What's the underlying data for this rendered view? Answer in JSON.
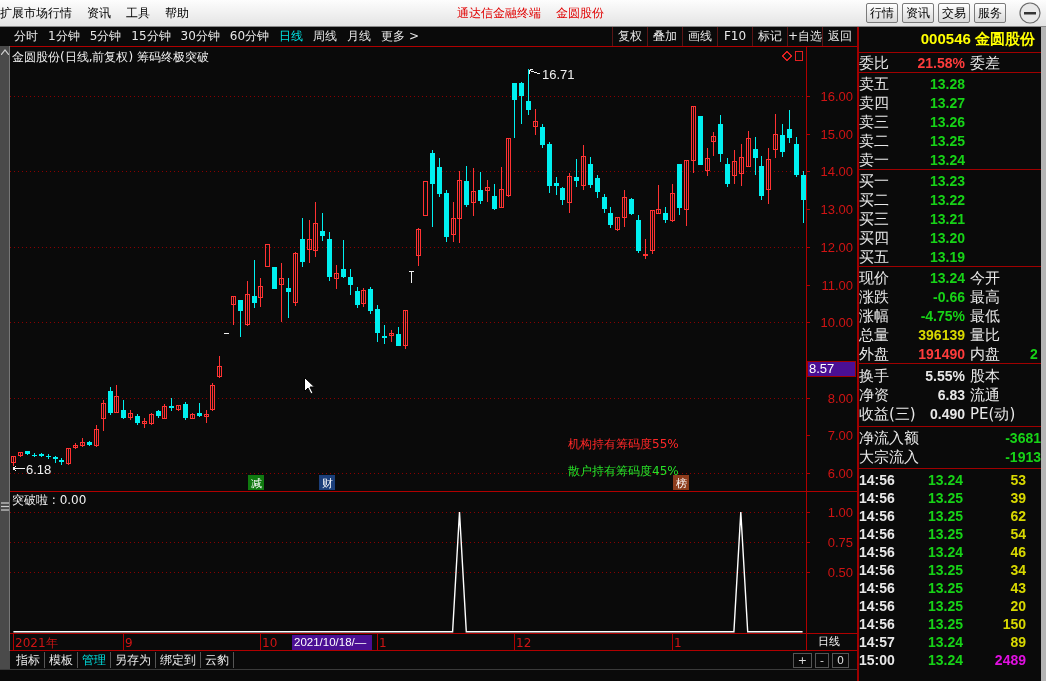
{
  "window": {
    "menu": [
      "扩展市场行情",
      "资讯",
      "工具",
      "帮助"
    ],
    "title": "通达信金融终端",
    "stock": "金圆股份",
    "buttons": [
      "行情",
      "资讯",
      "交易",
      "服务"
    ]
  },
  "toolbar": {
    "periods": [
      {
        "label": "分时",
        "selected": false
      },
      {
        "label": "1分钟",
        "selected": false
      },
      {
        "label": "5分钟",
        "selected": false
      },
      {
        "label": "15分钟",
        "selected": false
      },
      {
        "label": "30分钟",
        "selected": false
      },
      {
        "label": "60分钟",
        "selected": false
      },
      {
        "label": "日线",
        "selected": true
      },
      {
        "label": "周线",
        "selected": false
      },
      {
        "label": "月线",
        "selected": false
      },
      {
        "label": "更多 >",
        "selected": false
      }
    ],
    "actions": [
      "复权",
      "叠加",
      "画线",
      "F10",
      "标记",
      "+自选",
      "返回"
    ]
  },
  "chart": {
    "title": "金圆股份(日线,前复权) 筹码终极突破",
    "cursor_price": "8.57",
    "high_label": "16.71",
    "low_label": "6.18",
    "notes": [
      {
        "text": "机构持有筹码度55%",
        "color": "#ff2828"
      },
      {
        "text": "散户持有筹码度45%",
        "color": "#28e028"
      }
    ],
    "event_tags": [
      {
        "text": "减",
        "color": "#107a10"
      },
      {
        "text": "财",
        "color": "#1c3f7a"
      },
      {
        "text": "榜",
        "color": "#8c3c1c"
      }
    ],
    "chart_data": {
      "type": "candlestick",
      "grid": true,
      "categories": [
        null,
        null,
        null,
        null,
        null,
        null,
        null,
        null,
        null,
        null,
        null,
        null,
        null,
        null,
        null,
        null,
        null,
        null,
        null,
        null,
        null,
        null,
        null,
        null,
        null,
        null,
        null,
        null,
        null,
        null,
        null,
        null,
        null,
        null,
        null,
        null,
        null,
        null,
        null,
        null,
        null,
        null,
        null,
        null,
        null,
        null,
        null,
        null,
        null,
        null,
        null,
        null,
        null,
        null,
        null,
        null,
        null,
        null,
        null,
        null,
        null,
        null,
        null,
        null,
        null,
        null,
        null,
        null,
        null,
        null,
        null,
        null,
        null,
        null,
        null,
        null,
        null,
        null,
        null,
        null,
        null,
        null,
        null,
        null,
        null,
        null,
        null,
        null,
        null,
        null,
        null,
        null,
        null,
        null,
        null,
        null,
        null,
        null,
        null,
        null,
        null,
        null,
        null,
        null,
        null,
        null,
        null,
        null,
        null,
        null,
        null,
        null,
        null,
        null,
        null,
        null
      ],
      "ohlc": [
        [
          6.27,
          6.45,
          6.18,
          6.43
        ],
        [
          6.45,
          6.56,
          6.43,
          6.54
        ],
        [
          6.57,
          6.58,
          6.48,
          6.49
        ],
        [
          6.48,
          6.52,
          6.42,
          6.45
        ],
        [
          6.49,
          6.54,
          6.43,
          6.47
        ],
        [
          6.45,
          6.49,
          6.36,
          6.41
        ],
        [
          6.41,
          6.45,
          6.26,
          6.38
        ],
        [
          6.33,
          6.39,
          6.2,
          6.3
        ],
        [
          6.26,
          6.67,
          6.21,
          6.65
        ],
        [
          6.68,
          6.8,
          6.63,
          6.74
        ],
        [
          6.72,
          6.92,
          6.7,
          6.81
        ],
        [
          6.82,
          6.84,
          6.72,
          6.74
        ],
        [
          6.74,
          7.27,
          6.7,
          7.14
        ],
        [
          7.45,
          7.94,
          7.1,
          7.85
        ],
        [
          8.17,
          8.29,
          7.54,
          7.6
        ],
        [
          7.61,
          8.33,
          7.58,
          8.02
        ],
        [
          7.67,
          7.94,
          7.42,
          7.45
        ],
        [
          7.47,
          7.67,
          7.41,
          7.58
        ],
        [
          7.51,
          7.56,
          7.27,
          7.33
        ],
        [
          7.3,
          7.45,
          7.18,
          7.36
        ],
        [
          7.3,
          7.6,
          7.27,
          7.54
        ],
        [
          7.64,
          7.67,
          7.47,
          7.52
        ],
        [
          7.45,
          7.83,
          7.42,
          7.76
        ],
        [
          7.78,
          7.98,
          7.63,
          7.72
        ],
        [
          7.67,
          7.8,
          7.63,
          7.78
        ],
        [
          7.83,
          7.89,
          7.41,
          7.45
        ],
        [
          7.45,
          7.58,
          7.42,
          7.54
        ],
        [
          7.58,
          7.85,
          7.49,
          7.52
        ],
        [
          7.49,
          7.67,
          7.32,
          7.56
        ],
        [
          7.67,
          8.38,
          7.65,
          8.32
        ],
        [
          8.55,
          9.09,
          8.51,
          8.82
        ],
        [
          9.7,
          9.7,
          9.7,
          9.7
        ],
        [
          10.48,
          10.68,
          9.93,
          10.68
        ],
        [
          10.59,
          10.59,
          9.62,
          10.31
        ],
        [
          9.93,
          11.1,
          9.91,
          10.74
        ],
        [
          10.69,
          11.65,
          10.37,
          10.52
        ],
        [
          10.66,
          11.16,
          10.41,
          10.94
        ],
        [
          11.47,
          12.07,
          11.47,
          12.07
        ],
        [
          11.46,
          11.46,
          10.87,
          10.87
        ],
        [
          11.0,
          11.56,
          10.01,
          11.16
        ],
        [
          10.9,
          11.16,
          10.12,
          10.79
        ],
        [
          10.53,
          11.87,
          10.43,
          11.83
        ],
        [
          12.2,
          12.76,
          11.47,
          11.61
        ],
        [
          11.93,
          12.71,
          11.56,
          12.2
        ],
        [
          11.9,
          13.18,
          11.72,
          12.62
        ],
        [
          12.42,
          12.89,
          12.16,
          12.3
        ],
        [
          12.22,
          12.4,
          11.1,
          11.21
        ],
        [
          11.16,
          11.52,
          10.87,
          11.3
        ],
        [
          11.4,
          12.18,
          11.16,
          11.21
        ],
        [
          11.21,
          11.4,
          10.72,
          10.99
        ],
        [
          10.84,
          10.94,
          10.37,
          10.46
        ],
        [
          10.5,
          10.92,
          10.41,
          10.84
        ],
        [
          10.87,
          10.94,
          10.22,
          10.31
        ],
        [
          10.34,
          10.46,
          9.48,
          9.7
        ],
        [
          9.63,
          9.93,
          9.42,
          9.59
        ],
        [
          9.64,
          9.79,
          9.48,
          9.7
        ],
        [
          9.69,
          9.88,
          9.37,
          9.38
        ],
        [
          9.39,
          10.32,
          9.29,
          10.31
        ],
        [
          11.34,
          11.34,
          11.03,
          11.34
        ],
        [
          11.76,
          12.49,
          11.49,
          12.47
        ],
        [
          12.84,
          13.73,
          12.84,
          13.73
        ],
        [
          14.5,
          14.57,
          12.52,
          13.66
        ],
        [
          14.11,
          14.35,
          13.31,
          13.4
        ],
        [
          13.44,
          13.51,
          12.14,
          12.27
        ],
        [
          12.34,
          13.18,
          12.12,
          12.74
        ],
        [
          12.74,
          14.01,
          12.09,
          13.75
        ],
        [
          13.75,
          14.15,
          13.06,
          13.11
        ],
        [
          13.18,
          14.08,
          12.83,
          13.46
        ],
        [
          13.52,
          13.98,
          13.15,
          13.22
        ],
        [
          13.49,
          13.77,
          13.18,
          13.58
        ],
        [
          13.35,
          13.68,
          12.98,
          13.0
        ],
        [
          13.05,
          14.13,
          13.02,
          13.51
        ],
        [
          13.37,
          14.88,
          13.33,
          14.88
        ],
        [
          16.36,
          16.36,
          14.89,
          15.89
        ],
        [
          16.34,
          16.38,
          15.27,
          16.01
        ],
        [
          15.87,
          16.71,
          15.5,
          15.63
        ],
        [
          15.2,
          15.65,
          14.97,
          15.32
        ],
        [
          15.17,
          15.27,
          14.61,
          14.7
        ],
        [
          14.74,
          14.79,
          13.44,
          13.62
        ],
        [
          13.7,
          13.86,
          13.37,
          13.62
        ],
        [
          13.55,
          13.59,
          13.11,
          13.24
        ],
        [
          13.17,
          13.97,
          12.91,
          13.86
        ],
        [
          13.86,
          14.33,
          13.59,
          13.75
        ],
        [
          13.62,
          14.7,
          13.51,
          14.39
        ],
        [
          14.2,
          14.39,
          13.55,
          13.64
        ],
        [
          13.83,
          13.9,
          13.29,
          13.46
        ],
        [
          13.33,
          13.4,
          12.91,
          13.0
        ],
        [
          12.89,
          13.06,
          12.49,
          12.58
        ],
        [
          12.46,
          12.8,
          12.43,
          12.77
        ],
        [
          12.78,
          13.51,
          12.53,
          13.31
        ],
        [
          13.26,
          13.29,
          12.84,
          12.87
        ],
        [
          12.71,
          12.84,
          11.83,
          11.9
        ],
        [
          11.76,
          12.21,
          11.69,
          11.8
        ],
        [
          11.91,
          12.98,
          11.8,
          12.96
        ],
        [
          12.89,
          13.64,
          12.89,
          12.98
        ],
        [
          12.91,
          13.06,
          12.62,
          12.71
        ],
        [
          12.69,
          13.68,
          12.67,
          13.42
        ],
        [
          14.2,
          14.21,
          12.84,
          13.02
        ],
        [
          12.98,
          14.3,
          12.56,
          14.28
        ],
        [
          14.28,
          15.73,
          13.97,
          15.72
        ],
        [
          15.47,
          15.47,
          14.17,
          14.17
        ],
        [
          14.02,
          14.61,
          13.88,
          14.35
        ],
        [
          14.79,
          15.05,
          14.41,
          14.94
        ],
        [
          15.26,
          15.5,
          14.26,
          14.46
        ],
        [
          14.21,
          14.35,
          13.59,
          13.67
        ],
        [
          13.9,
          14.57,
          13.68,
          14.26
        ],
        [
          13.95,
          14.74,
          13.62,
          14.37
        ],
        [
          14.14,
          15.07,
          14.11,
          14.88
        ],
        [
          14.59,
          14.92,
          13.9,
          14.35
        ],
        [
          14.14,
          14.41,
          13.24,
          13.36
        ],
        [
          13.51,
          14.63,
          13.15,
          14.33
        ],
        [
          14.57,
          15.52,
          14.35,
          14.98
        ],
        [
          14.98,
          15.27,
          14.39,
          14.52
        ],
        [
          15.12,
          15.63,
          14.76,
          14.88
        ],
        [
          14.73,
          14.92,
          13.86,
          13.9
        ],
        [
          13.9,
          14.01,
          12.64,
          13.24
        ]
      ],
      "ylim": [
        5.52,
        17.33
      ],
      "yticks": [
        {
          "value": 16,
          "label": "16.00"
        },
        {
          "value": 15,
          "label": "15.00"
        },
        {
          "value": 14,
          "label": "14.00"
        },
        {
          "value": 13,
          "label": "13.00"
        },
        {
          "value": 12,
          "label": "12.00"
        },
        {
          "value": 11,
          "label": "11.00"
        },
        {
          "value": 10,
          "label": "10.00"
        },
        {
          "value": 8,
          "label": "8.00"
        },
        {
          "value": 7,
          "label": "7.00"
        },
        {
          "value": 6,
          "label": "6.00"
        }
      ]
    }
  },
  "indicator": {
    "title": "突破啦 : 0.00",
    "chart_data": {
      "type": "line",
      "grid": true,
      "series": [
        {
          "color": "#ffffff",
          "values": [
            0,
            0,
            0,
            0,
            0,
            0,
            0,
            0,
            0,
            0,
            0,
            0,
            0,
            0,
            0,
            0,
            0,
            0,
            0,
            0,
            0,
            0,
            0,
            0,
            0,
            0,
            0,
            0,
            0,
            0,
            0,
            0,
            0,
            0,
            0,
            0,
            0,
            0,
            0,
            0,
            0,
            0,
            0,
            0,
            0,
            0,
            0,
            0,
            0,
            0,
            0,
            0,
            0,
            0,
            0,
            0,
            0,
            0,
            0,
            0,
            0,
            0,
            0,
            0,
            0,
            1,
            0,
            0,
            0,
            0,
            0,
            0,
            0,
            0,
            0,
            0,
            0,
            0,
            0,
            0,
            0,
            0,
            0,
            0,
            0,
            0,
            0,
            0,
            0,
            0,
            0,
            0,
            0,
            0,
            0,
            0,
            0,
            0,
            0,
            0,
            0,
            0,
            0,
            0,
            0,
            0,
            1,
            0,
            0,
            0,
            0,
            0,
            0,
            0,
            0,
            0
          ]
        }
      ],
      "ylim": [
        -0.01,
        1.175
      ],
      "yticks": [
        {
          "value": 1,
          "label": "1.00"
        },
        {
          "value": 0.75,
          "label": "0.75"
        },
        {
          "value": 0.5,
          "label": "0.50"
        }
      ]
    }
  },
  "date_axis": {
    "labels": [
      "2021年",
      "9",
      "10",
      "1",
      "12",
      "1"
    ],
    "cursor_date": "2021/10/18/—",
    "period": "日线"
  },
  "bottom_tabs": [
    {
      "label": "指标",
      "selected": false
    },
    {
      "label": "模板",
      "selected": false
    },
    {
      "label": "管理",
      "selected": true
    },
    {
      "label": "另存为",
      "selected": false
    },
    {
      "label": "绑定到",
      "selected": false
    },
    {
      "label": "云豹",
      "selected": false
    }
  ],
  "zoom_controls": [
    "+",
    "-",
    "0"
  ],
  "quote": {
    "header": "000546 金圆股份",
    "ratio": {
      "label": "委比",
      "value": "21.58%",
      "label2": "委差"
    },
    "asks": [
      {
        "label": "卖五",
        "price": "13.28"
      },
      {
        "label": "卖四",
        "price": "13.27"
      },
      {
        "label": "卖三",
        "price": "13.26"
      },
      {
        "label": "卖二",
        "price": "13.25"
      },
      {
        "label": "卖一",
        "price": "13.24"
      }
    ],
    "bids": [
      {
        "label": "买一",
        "price": "13.23"
      },
      {
        "label": "买二",
        "price": "13.22"
      },
      {
        "label": "买三",
        "price": "13.21"
      },
      {
        "label": "买四",
        "price": "13.20"
      },
      {
        "label": "买五",
        "price": "13.19"
      }
    ],
    "stats": [
      {
        "label": "现价",
        "value": "13.24",
        "color": "#17d317",
        "label2": "今开"
      },
      {
        "label": "涨跌",
        "value": "-0.66",
        "color": "#17d317",
        "label2": "最高"
      },
      {
        "label": "涨幅",
        "value": "-4.75%",
        "color": "#17d317",
        "label2": "最低"
      },
      {
        "label": "总量",
        "value": "396139",
        "color": "#d8d800",
        "label2": "量比"
      },
      {
        "label": "外盘",
        "value": "191490",
        "color": "#ff3c3c",
        "label2": "内盘",
        "value2": "2"
      }
    ],
    "fundamentals": [
      {
        "label": "换手",
        "value": "5.55%",
        "label2": "股本"
      },
      {
        "label": "净资",
        "value": "6.83",
        "label2": "流通"
      },
      {
        "label": "收益(三)",
        "value": "0.490",
        "label2": "PE(动)"
      }
    ],
    "flows": [
      {
        "label": "净流入额",
        "value": "-3681"
      },
      {
        "label": "大宗流入",
        "value": "-1913"
      }
    ],
    "ticks": [
      {
        "time": "14:56",
        "price": "13.24",
        "volume": "53",
        "color": "#d8d800"
      },
      {
        "time": "14:56",
        "price": "13.25",
        "volume": "39",
        "color": "#d8d800"
      },
      {
        "time": "14:56",
        "price": "13.25",
        "volume": "62",
        "color": "#d8d800"
      },
      {
        "time": "14:56",
        "price": "13.25",
        "volume": "54",
        "color": "#d8d800"
      },
      {
        "time": "14:56",
        "price": "13.24",
        "volume": "46",
        "color": "#d8d800"
      },
      {
        "time": "14:56",
        "price": "13.25",
        "volume": "34",
        "color": "#d8d800"
      },
      {
        "time": "14:56",
        "price": "13.25",
        "volume": "43",
        "color": "#d8d800"
      },
      {
        "time": "14:56",
        "price": "13.25",
        "volume": "20",
        "color": "#d8d800"
      },
      {
        "time": "14:56",
        "price": "13.25",
        "volume": "150",
        "color": "#d8d800"
      },
      {
        "time": "14:57",
        "price": "13.24",
        "volume": "89",
        "color": "#d8d800"
      },
      {
        "time": "15:00",
        "price": "13.24",
        "volume": "2489",
        "color": "#e010e0"
      }
    ]
  }
}
